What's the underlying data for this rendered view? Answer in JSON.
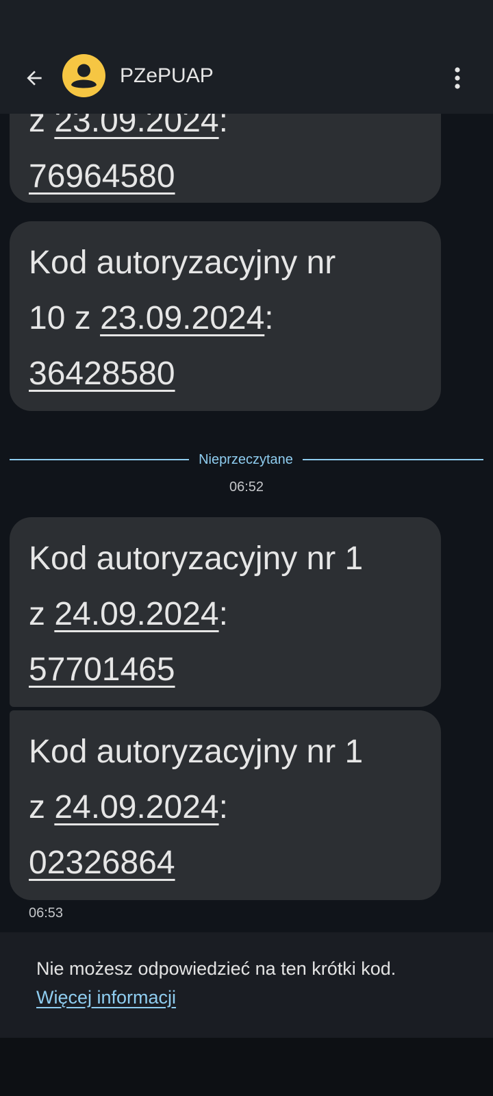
{
  "header": {
    "contact_name": "PZePUAP"
  },
  "messages": [
    {
      "prefix": "z ",
      "date": "23.09.2024",
      "colon": ":",
      "code": "76964580"
    },
    {
      "line1": "Kod autoryzacyjny nr",
      "prefix": "10 z ",
      "date": "23.09.2024",
      "colon": ":",
      "code": "36428580"
    },
    {
      "line1": "Kod autoryzacyjny nr 1",
      "prefix": "z ",
      "date": "24.09.2024",
      "colon": ":",
      "code": "57701465"
    },
    {
      "line1": "Kod autoryzacyjny nr 1",
      "prefix": "z ",
      "date": "24.09.2024",
      "colon": ":",
      "code": "02326864"
    }
  ],
  "divider": {
    "label": "Nieprzeczytane"
  },
  "timestamps": {
    "unread_time": "06:52",
    "last_time": "06:53"
  },
  "footer": {
    "notice": "Nie możesz odpowiedzieć na ten krótki kod.",
    "more_link": "Więcej informacji"
  },
  "colors": {
    "accent": "#8fcdf0",
    "avatar": "#f6c643",
    "bubble": "#2c2f33",
    "background": "#10141a"
  },
  "icons": {
    "back": "arrow-back-icon",
    "avatar": "person-icon",
    "menu": "more-vert-icon"
  }
}
